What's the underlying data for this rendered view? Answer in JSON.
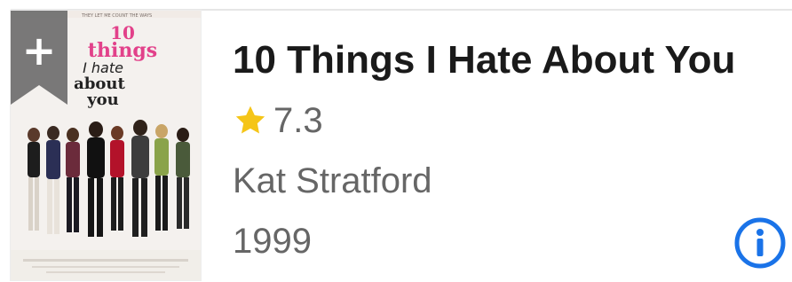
{
  "item": {
    "title": "10 Things I Hate About You",
    "rating": "7.3",
    "character": "Kat Stratford",
    "year": "1999"
  },
  "poster": {
    "title_line1": "10",
    "title_line2": "things",
    "title_line3": "I hate",
    "title_line4": "about",
    "title_line5": "you",
    "tagline": "THEY LET ME COUNT THE WAYS",
    "background_color": "#f4f1ee",
    "title_color": "#e2418a"
  },
  "icons": {
    "add": "plus-ribbon-icon",
    "rating": "star-icon",
    "info": "info-circle-icon"
  },
  "colors": {
    "ribbon": "#6e6e6e",
    "star": "#f5c518",
    "info": "#1a73e8",
    "title_text": "#1a1a1a",
    "meta_text": "#666666"
  }
}
